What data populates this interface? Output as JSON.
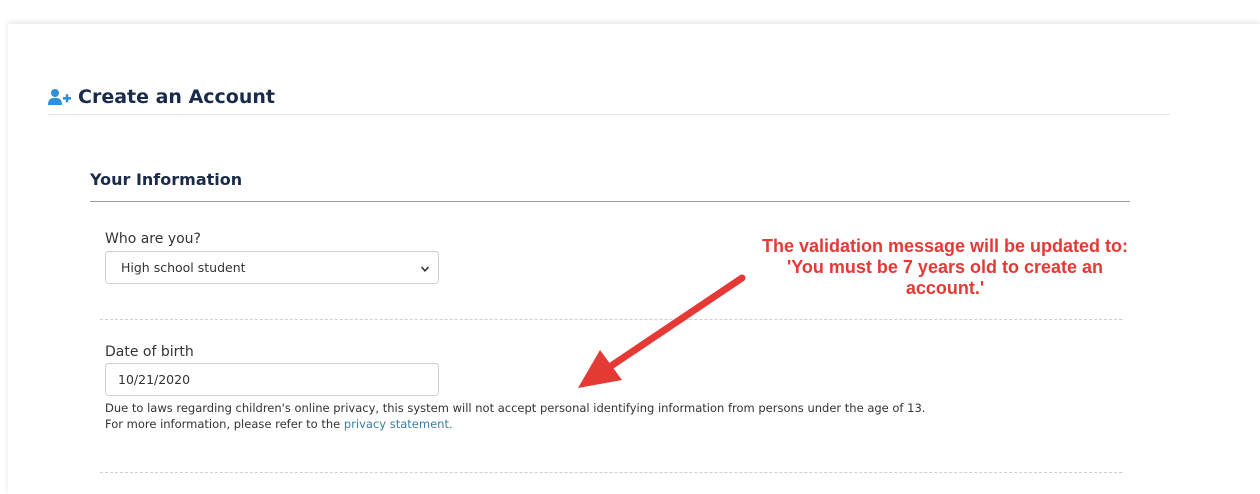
{
  "page": {
    "title": "Create an Account",
    "title_icon": "add-user-icon"
  },
  "section": {
    "title": "Your Information"
  },
  "fields": {
    "role": {
      "label": "Who are you?",
      "selected": "High school student"
    },
    "dob": {
      "label": "Date of birth",
      "value": "10/21/2020",
      "help_line1": "Due to laws regarding children's online privacy, this system will not accept personal identifying information from persons under the age of 13.",
      "help_line2_prefix": "For more information, please refer to the ",
      "help_link": "privacy statement."
    }
  },
  "annotation": {
    "line1": "The validation message will be updated to:",
    "line2": "'You must be 7 years old to create an",
    "line3": "account.'",
    "color": "#e53935"
  },
  "colors": {
    "heading": "#1a2b49",
    "link": "#3a7ea3",
    "icon": "#2f8fd8"
  }
}
